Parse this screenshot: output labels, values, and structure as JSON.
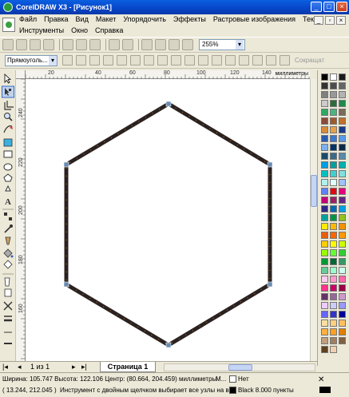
{
  "window": {
    "title": "CorelDRAW X3 - [Рисунок1]"
  },
  "menu": {
    "row1": [
      "Файл",
      "Правка",
      "Вид",
      "Макет",
      "Упорядочить",
      "Эффекты",
      "Растровые изображения",
      "Текст"
    ],
    "row2": [
      "Инструменты",
      "Окно",
      "Справка"
    ]
  },
  "toolbar": {
    "zoom_value": "255%"
  },
  "propbar": {
    "object_selector": "Прямоуголь...",
    "trailing_label": "Сокращат"
  },
  "ruler": {
    "top_ticks": [
      "20",
      "40",
      "60",
      "80",
      "100",
      "120",
      "140"
    ],
    "unit": "миллиметры",
    "left_ticks": [
      "240",
      "220",
      "200",
      "180",
      "160"
    ]
  },
  "pages": {
    "nav_label": "1 из 1",
    "tab_label": "Страница 1"
  },
  "status": {
    "dimensions": "Ширина: 105.747  Высота: 122.106  Центр: (80.664, 204.459)  миллиметры",
    "layer_hint": "М...",
    "fill_label": "Нет",
    "coords": "( 13.244, 212.045 )",
    "hint": "Инструмент с двойным щелчком выбирает все узлы на в...",
    "outline_label": "Black  8.000 пункты"
  },
  "colors": {
    "titlebar": "#0845c8",
    "shape_outline": "#2a2220",
    "node_dot": "#c8701a"
  },
  "palette_colors": [
    "#000000",
    "#ffffff",
    "#1a1a1a",
    "#333333",
    "#4d4d4d",
    "#666666",
    "#808080",
    "#999999",
    "#b3b3b3",
    "#cccccc",
    "#2e6b3a",
    "#1f8a4e",
    "#2fa866",
    "#4ab580",
    "#7a6a5a",
    "#8a4a3a",
    "#a05a2a",
    "#c0702a",
    "#d88a3a",
    "#e8a04a",
    "#1a3a8a",
    "#2a5ab0",
    "#3a7ad0",
    "#5a9ae8",
    "#7ab0f0",
    "#003366",
    "#0a2a4a",
    "#1a4a6a",
    "#3a6a8a",
    "#5a8aaa",
    "#009fe3",
    "#00a0a0",
    "#00b0b0",
    "#00c0c0",
    "#40d0d0",
    "#80e0e0",
    "#b0f0f0",
    "#e0ffff",
    "#a0c0ff",
    "#6080ff",
    "#e30613",
    "#e4007c",
    "#c2007a",
    "#9e1f63",
    "#662483",
    "#312783",
    "#0069b4",
    "#009fe3",
    "#00a19a",
    "#009640",
    "#95c11f",
    "#ffed00",
    "#fbba00",
    "#f39200",
    "#e95d0f",
    "#ff6600",
    "#ff9900",
    "#ffcc00",
    "#ffff00",
    "#ccff00",
    "#99ff00",
    "#66ff33",
    "#33cc33",
    "#009933",
    "#006633",
    "#339966",
    "#66cc99",
    "#99ffcc",
    "#ccffee",
    "#ffccee",
    "#ff99cc",
    "#ff66aa",
    "#ff3388",
    "#cc0066",
    "#990044",
    "#663366",
    "#996699",
    "#cc99cc",
    "#eeccff",
    "#ccccff",
    "#9999ff",
    "#6666ff",
    "#3333cc",
    "#000099",
    "#ffe0a0",
    "#ffd080",
    "#ffc060",
    "#ffb040",
    "#ffa020",
    "#e08000",
    "#c0a080",
    "#a08060",
    "#806040",
    "#604020",
    "#f0d0b0"
  ]
}
